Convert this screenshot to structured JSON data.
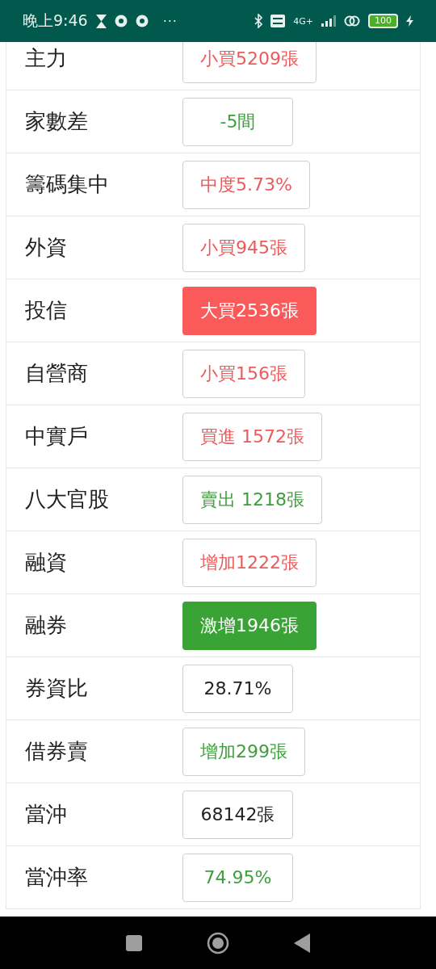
{
  "status_bar": {
    "time": "晚上9:46",
    "dots": "···",
    "network": "4G+",
    "battery": "100"
  },
  "rows": [
    {
      "label": "主力",
      "value": "小買5209張",
      "color": "#ea5b5b",
      "filled": false
    },
    {
      "label": "家數差",
      "value": "-5間",
      "color": "#3d9e3d",
      "filled": false
    },
    {
      "label": "籌碼集中",
      "value": "中度5.73%",
      "color": "#ea5b5b",
      "filled": false
    },
    {
      "label": "外資",
      "value": "小買945張",
      "color": "#ea5b5b",
      "filled": false
    },
    {
      "label": "投信",
      "value": "大買2536張",
      "color": "#fa5a5a",
      "filled": true
    },
    {
      "label": "自營商",
      "value": "小買156張",
      "color": "#ea5b5b",
      "filled": false
    },
    {
      "label": "中實戶",
      "value": "買進 1572張",
      "color": "#ea5b5b",
      "filled": false
    },
    {
      "label": "八大官股",
      "value": "賣出 1218張",
      "color": "#3d9e3d",
      "filled": false
    },
    {
      "label": "融資",
      "value": "增加1222張",
      "color": "#ea5b5b",
      "filled": false
    },
    {
      "label": "融券",
      "value": "激增1946張",
      "color": "#3aa336",
      "filled": true
    },
    {
      "label": "券資比",
      "value": "28.71%",
      "color": "#222222",
      "filled": false
    },
    {
      "label": "借券賣",
      "value": "增加299張",
      "color": "#3d9e3d",
      "filled": false
    },
    {
      "label": "當沖",
      "value": "68142張",
      "color": "#222222",
      "filled": false
    },
    {
      "label": "當沖率",
      "value": "74.95%",
      "color": "#3d9e3d",
      "filled": false
    }
  ]
}
